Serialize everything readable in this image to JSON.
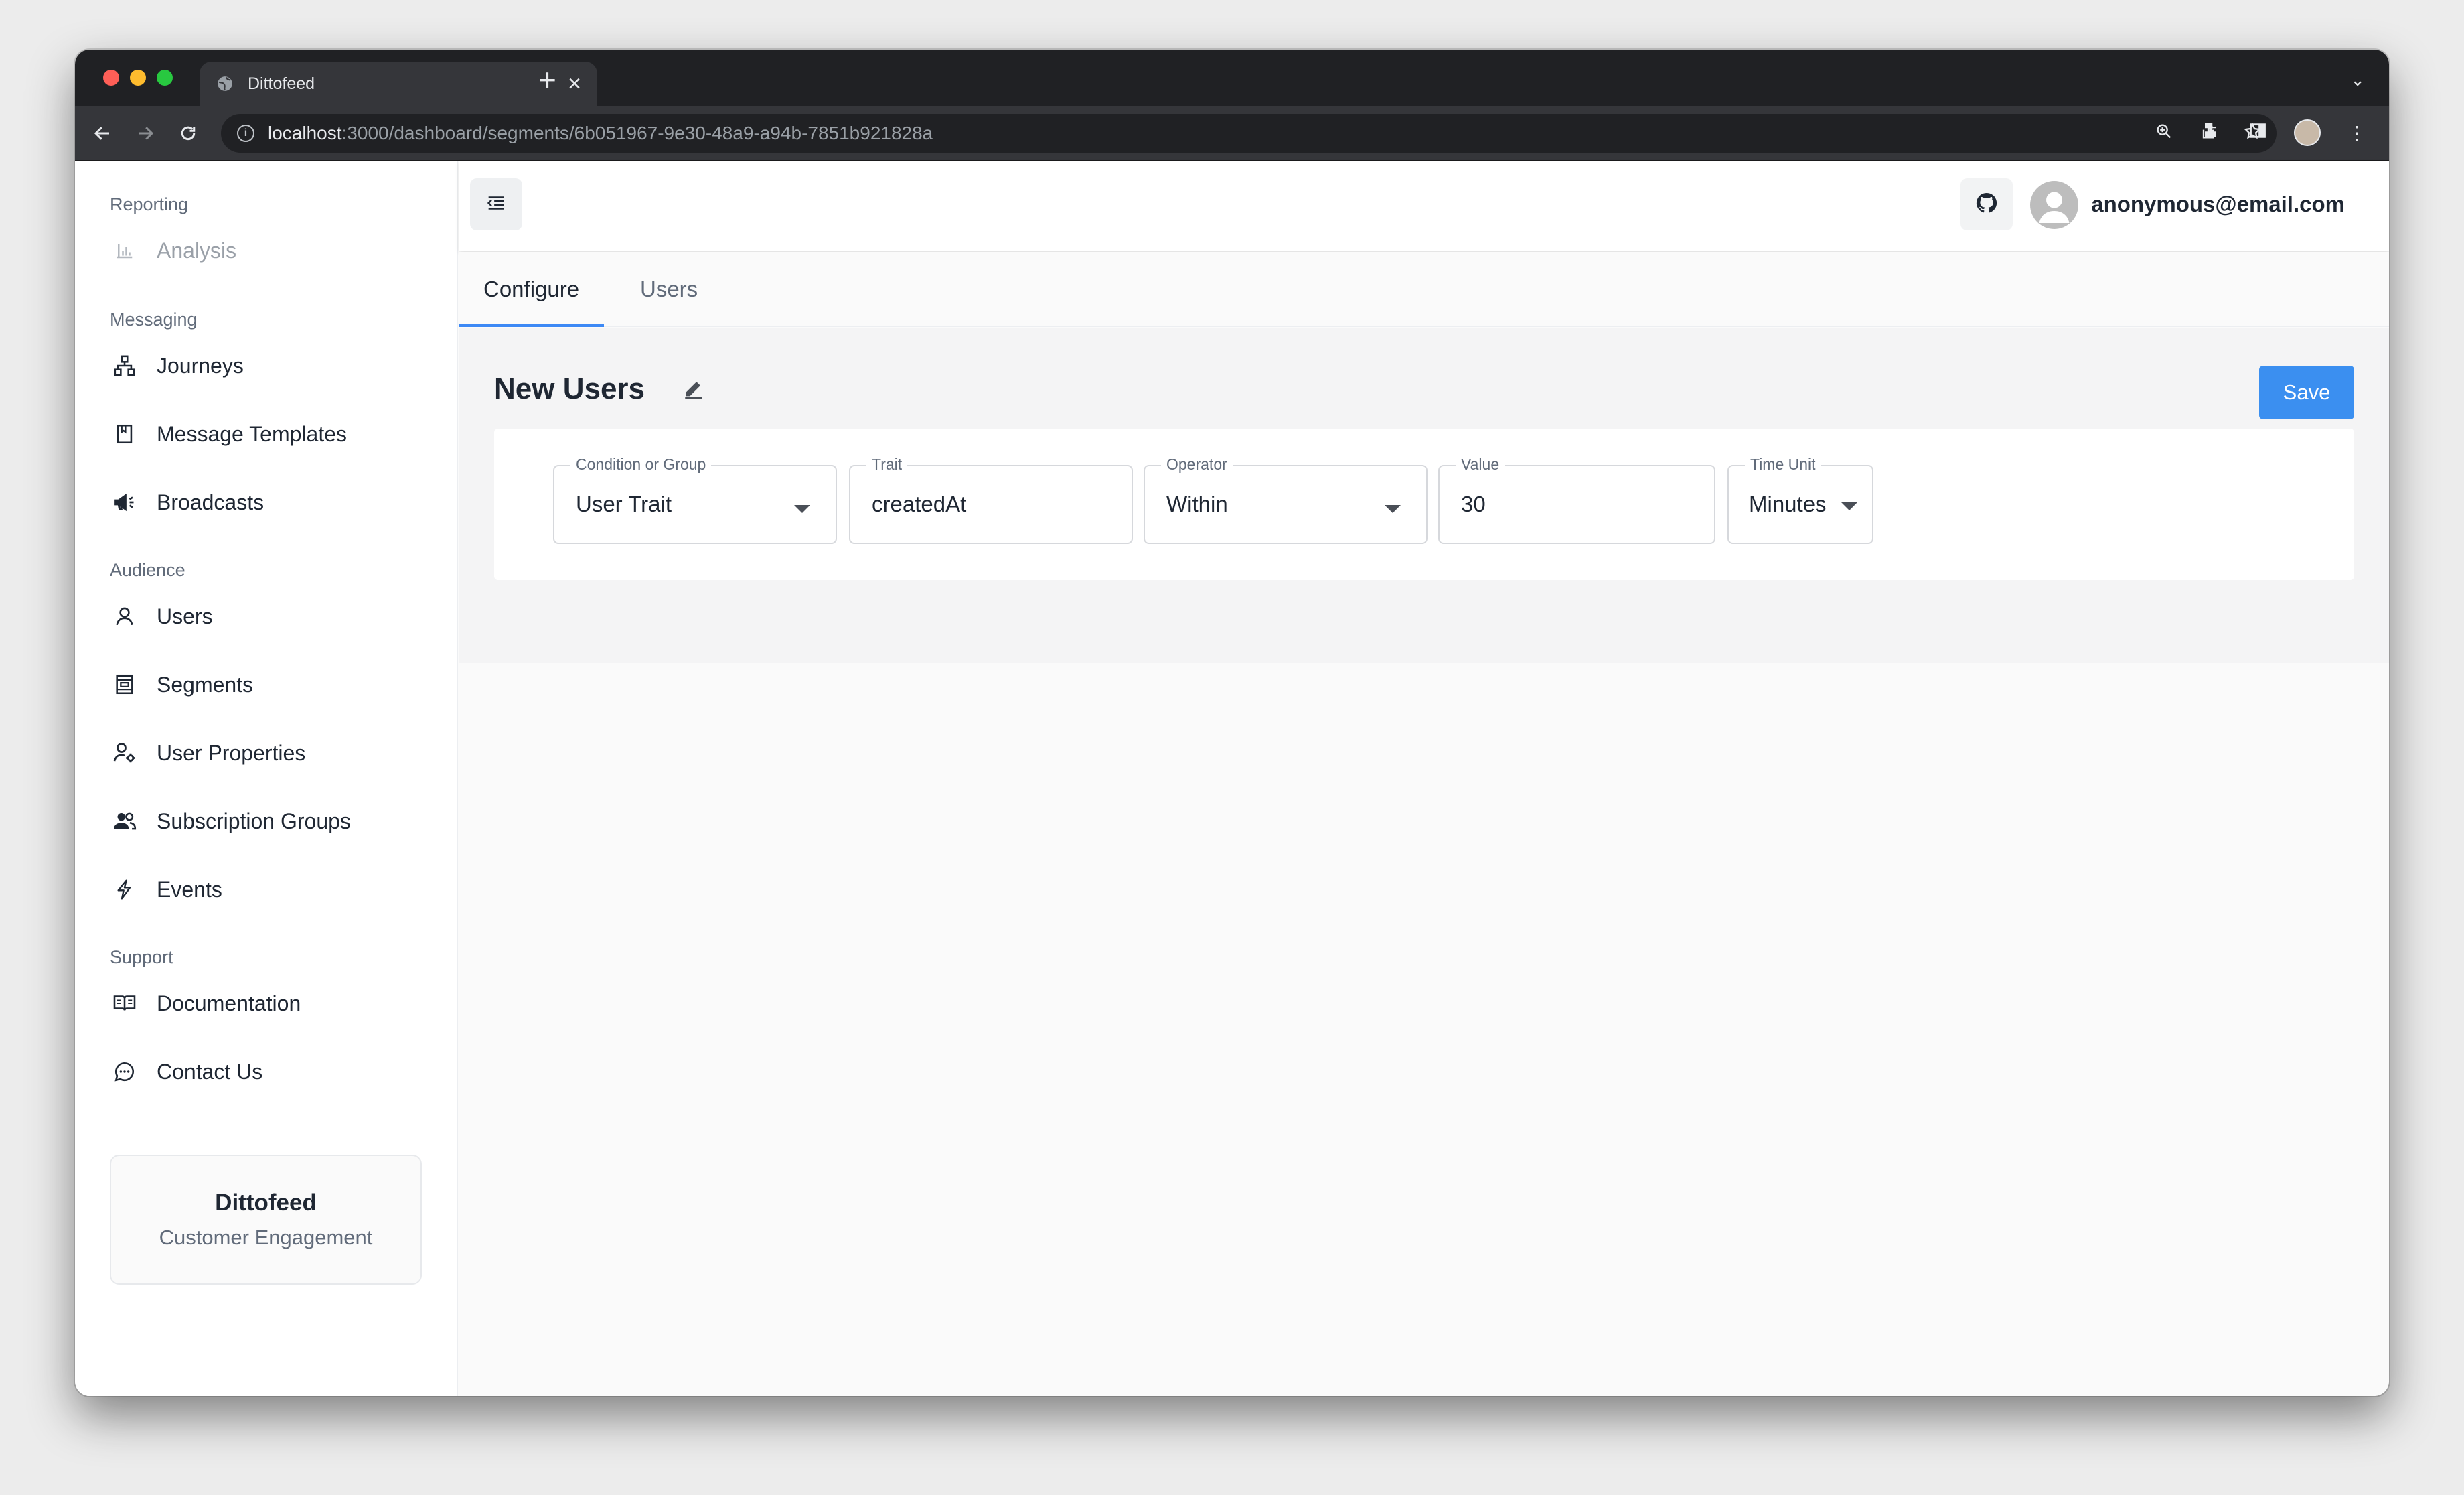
{
  "browser": {
    "tab_title": "Dittofeed",
    "url_host": "localhost",
    "url_path": ":3000/dashboard/segments/6b051967-9e30-48a9-a94b-7851b921828a"
  },
  "sidebar": {
    "sections": [
      {
        "label": "Reporting",
        "items": [
          {
            "label": "Analysis",
            "icon": "bar-chart-icon",
            "disabled": true
          }
        ]
      },
      {
        "label": "Messaging",
        "items": [
          {
            "label": "Journeys",
            "icon": "sitemap-icon"
          },
          {
            "label": "Message Templates",
            "icon": "book-icon"
          },
          {
            "label": "Broadcasts",
            "icon": "megaphone-icon"
          }
        ]
      },
      {
        "label": "Audience",
        "items": [
          {
            "label": "Users",
            "icon": "user-icon"
          },
          {
            "label": "Segments",
            "icon": "list-box-icon"
          },
          {
            "label": "User Properties",
            "icon": "user-gear-icon"
          },
          {
            "label": "Subscription Groups",
            "icon": "users-icon"
          },
          {
            "label": "Events",
            "icon": "lightning-icon"
          }
        ]
      },
      {
        "label": "Support",
        "items": [
          {
            "label": "Documentation",
            "icon": "open-book-icon"
          },
          {
            "label": "Contact Us",
            "icon": "chat-icon"
          }
        ]
      }
    ],
    "brand": {
      "name": "Dittofeed",
      "subtitle": "Customer Engagement"
    }
  },
  "header": {
    "user_email": "anonymous@email.com"
  },
  "tabs": [
    {
      "label": "Configure",
      "active": true
    },
    {
      "label": "Users",
      "active": false
    }
  ],
  "segment": {
    "title": "New Users",
    "save_label": "Save",
    "fields": [
      {
        "label": "Condition or Group",
        "value": "User Trait",
        "type": "select"
      },
      {
        "label": "Trait",
        "value": "createdAt",
        "type": "input"
      },
      {
        "label": "Operator",
        "value": "Within",
        "type": "select"
      },
      {
        "label": "Value",
        "value": "30",
        "type": "input"
      },
      {
        "label": "Time Unit",
        "value": "Minutes",
        "type": "select"
      }
    ]
  },
  "colors": {
    "accent": "#3b8ff0",
    "tab_indicator": "#3d89f5",
    "text_primary": "#1f2733",
    "text_secondary": "#616b7a"
  }
}
